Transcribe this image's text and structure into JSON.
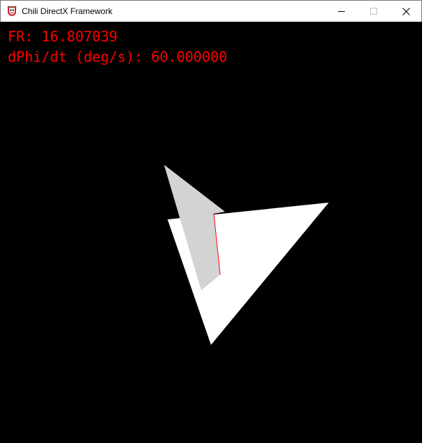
{
  "window": {
    "title": "Chili DirectX Framework",
    "icons": {
      "app": "chili-app-icon",
      "minimize": "minimize-icon",
      "maximize": "maximize-icon",
      "close": "close-icon"
    }
  },
  "hud": {
    "frame_rate_text": "FR: 16.807039",
    "dphi_text": "dPhi/dt (deg/s): 60.000000",
    "text_color": "#ff0000"
  },
  "scene": {
    "background": "#000000",
    "front_triangle_color": "#ffffff",
    "back_triangle_color": "#d3d3d3",
    "edge_highlight_color": "#ff0000"
  }
}
